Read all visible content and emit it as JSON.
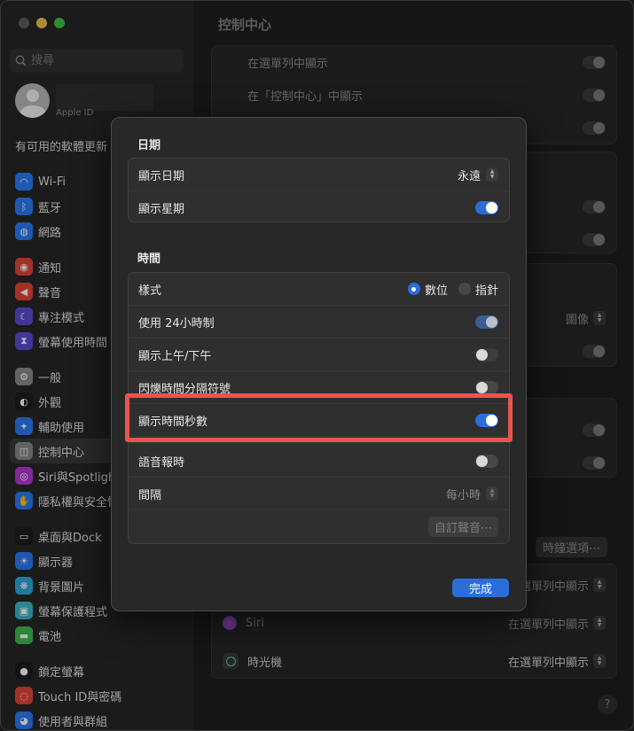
{
  "sidebar": {
    "search_placeholder": "搜尋",
    "account_sub": "Apple ID",
    "update_text": "有可用的軟體更新",
    "groups": [
      [
        {
          "label": "Wi-Fi",
          "icon": "wifi-icon",
          "color": "#2a7bf6"
        },
        {
          "label": "藍牙",
          "icon": "bluetooth-icon",
          "color": "#2a7bf6"
        },
        {
          "label": "網路",
          "icon": "globe-icon",
          "color": "#2a7bf6"
        }
      ],
      [
        {
          "label": "通知",
          "icon": "bell-icon",
          "color": "#e5433b"
        },
        {
          "label": "聲音",
          "icon": "speaker-icon",
          "color": "#e5433b"
        },
        {
          "label": "專注模式",
          "icon": "moon-icon",
          "color": "#5b4bd1"
        },
        {
          "label": "螢幕使用時間",
          "icon": "hourglass-icon",
          "color": "#5b4bd1"
        }
      ],
      [
        {
          "label": "一般",
          "icon": "gear-icon",
          "color": "#8a8a8a"
        },
        {
          "label": "外觀",
          "icon": "appearance-icon",
          "color": "#1c1c1c"
        },
        {
          "label": "輔助使用",
          "icon": "accessibility-icon",
          "color": "#2a7bf6"
        },
        {
          "label": "控制中心",
          "icon": "control-center-icon",
          "color": "#8a8a8a",
          "active": true
        },
        {
          "label": "Siri與Spotlight",
          "icon": "siri-icon",
          "color": "#b23ad4"
        },
        {
          "label": "隱私權與安全性",
          "icon": "hand-icon",
          "color": "#2a7bf6"
        }
      ],
      [
        {
          "label": "桌面與Dock",
          "icon": "dock-icon",
          "color": "#1c1c1c"
        },
        {
          "label": "顯示器",
          "icon": "sun-icon",
          "color": "#2a7bf6"
        },
        {
          "label": "背景圖片",
          "icon": "wallpaper-icon",
          "color": "#2fa8d8"
        },
        {
          "label": "螢幕保護程式",
          "icon": "screensaver-icon",
          "color": "#3ab7c6"
        },
        {
          "label": "電池",
          "icon": "battery-icon",
          "color": "#3fb950"
        }
      ],
      [
        {
          "label": "鎖定螢幕",
          "icon": "lock-icon",
          "color": "#1c1c1c"
        },
        {
          "label": "Touch ID與密碼",
          "icon": "fingerprint-icon",
          "color": "#e5433b"
        },
        {
          "label": "使用者與群組",
          "icon": "users-icon",
          "color": "#2a7bf6"
        }
      ]
    ]
  },
  "main": {
    "title": "控制中心",
    "bg_rows": {
      "menu_bar": "在選單列中顯示",
      "control_center": "在「控制中心」中顯示",
      "image_select": "圖像",
      "clock_options_button": "時鐘選項⋯",
      "spotlight_select": "在選單列中顯示",
      "siri_label": "Siri",
      "siri_select": "在選單列中顯示",
      "timemachine_label": "時光機",
      "timemachine_select": "在選單列中顯示"
    },
    "help": "?"
  },
  "sheet": {
    "date_title": "日期",
    "show_date_label": "顯示日期",
    "show_date_value": "永遠",
    "show_weekday_label": "顯示星期",
    "time_title": "時間",
    "style_label": "樣式",
    "style_digital": "數位",
    "style_analog": "指針",
    "use_24h_label": "使用 24小時制",
    "show_ampm_label": "顯示上午/下午",
    "flash_separators_label": "閃爍時間分隔符號",
    "show_seconds_label": "顯示時間秒數",
    "announce_label": "語音報時",
    "interval_label": "間隔",
    "interval_value": "每小時",
    "custom_voice_button": "自訂聲音⋯",
    "done_button": "完成"
  }
}
